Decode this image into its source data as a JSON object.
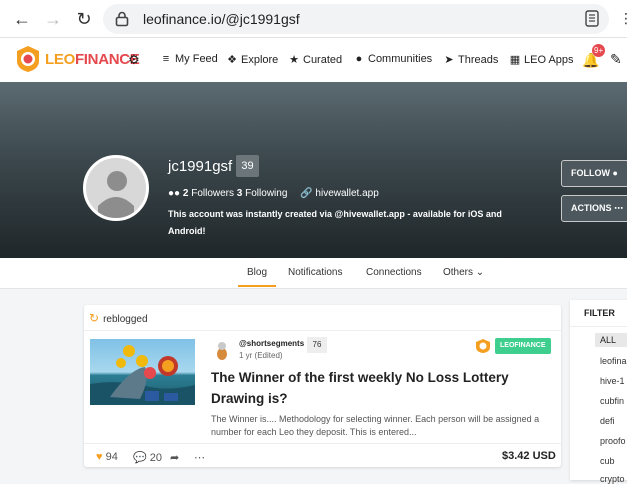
{
  "browser": {
    "url": "leofinance.io/@jc1991gsf"
  },
  "nav": {
    "brand_part1": "LEO",
    "brand_part2": "FINANCE",
    "items": [
      {
        "label": "My Feed",
        "icon": "rss-icon"
      },
      {
        "label": "Explore",
        "icon": "compass-icon"
      },
      {
        "label": "Curated",
        "icon": "star-icon"
      },
      {
        "label": "Communities",
        "icon": "users-icon"
      },
      {
        "label": "Threads",
        "icon": "paper-plane-icon"
      },
      {
        "label": "LEO Apps",
        "icon": "grid-icon"
      }
    ],
    "notification_count": "9+"
  },
  "profile": {
    "username": "jc1991gsf",
    "reputation": "39",
    "followers_count": "2",
    "followers_label": "Followers",
    "following_count": "3",
    "following_label": "Following",
    "website": "hivewallet.app",
    "bio": "This account was instantly created via @hivewallet.app - available for iOS and Android!",
    "follow_label": "FOLLOW",
    "actions_label": "ACTIONS"
  },
  "tabs": [
    {
      "label": "Blog",
      "active": true
    },
    {
      "label": "Notifications",
      "active": false
    },
    {
      "label": "Connections",
      "active": false
    },
    {
      "label": "Others",
      "active": false
    }
  ],
  "post": {
    "reblog_label": "reblogged",
    "author": "@shortsegments",
    "author_rep": "76",
    "time": "1 yr (Edited)",
    "community": "LEOFINANCE",
    "title": "The Winner of the first weekly No Loss Lottery Drawing is?",
    "excerpt": "The Winner is.... Methodology for selecting winner. Each person will be assigned a number for each Leo they deposit. This is entered...",
    "votes": "94",
    "comments": "20",
    "payout": "$3.42 USD"
  },
  "filter": {
    "title": "FILTER",
    "all_label": "ALL",
    "items": [
      "leofina",
      "hive-1",
      "cubfin",
      "defi",
      "proofo",
      "cub",
      "crypto"
    ]
  },
  "colors": {
    "accent": "#f59f21",
    "brand_red": "#e5484d",
    "community_green": "#3ecf8e"
  }
}
